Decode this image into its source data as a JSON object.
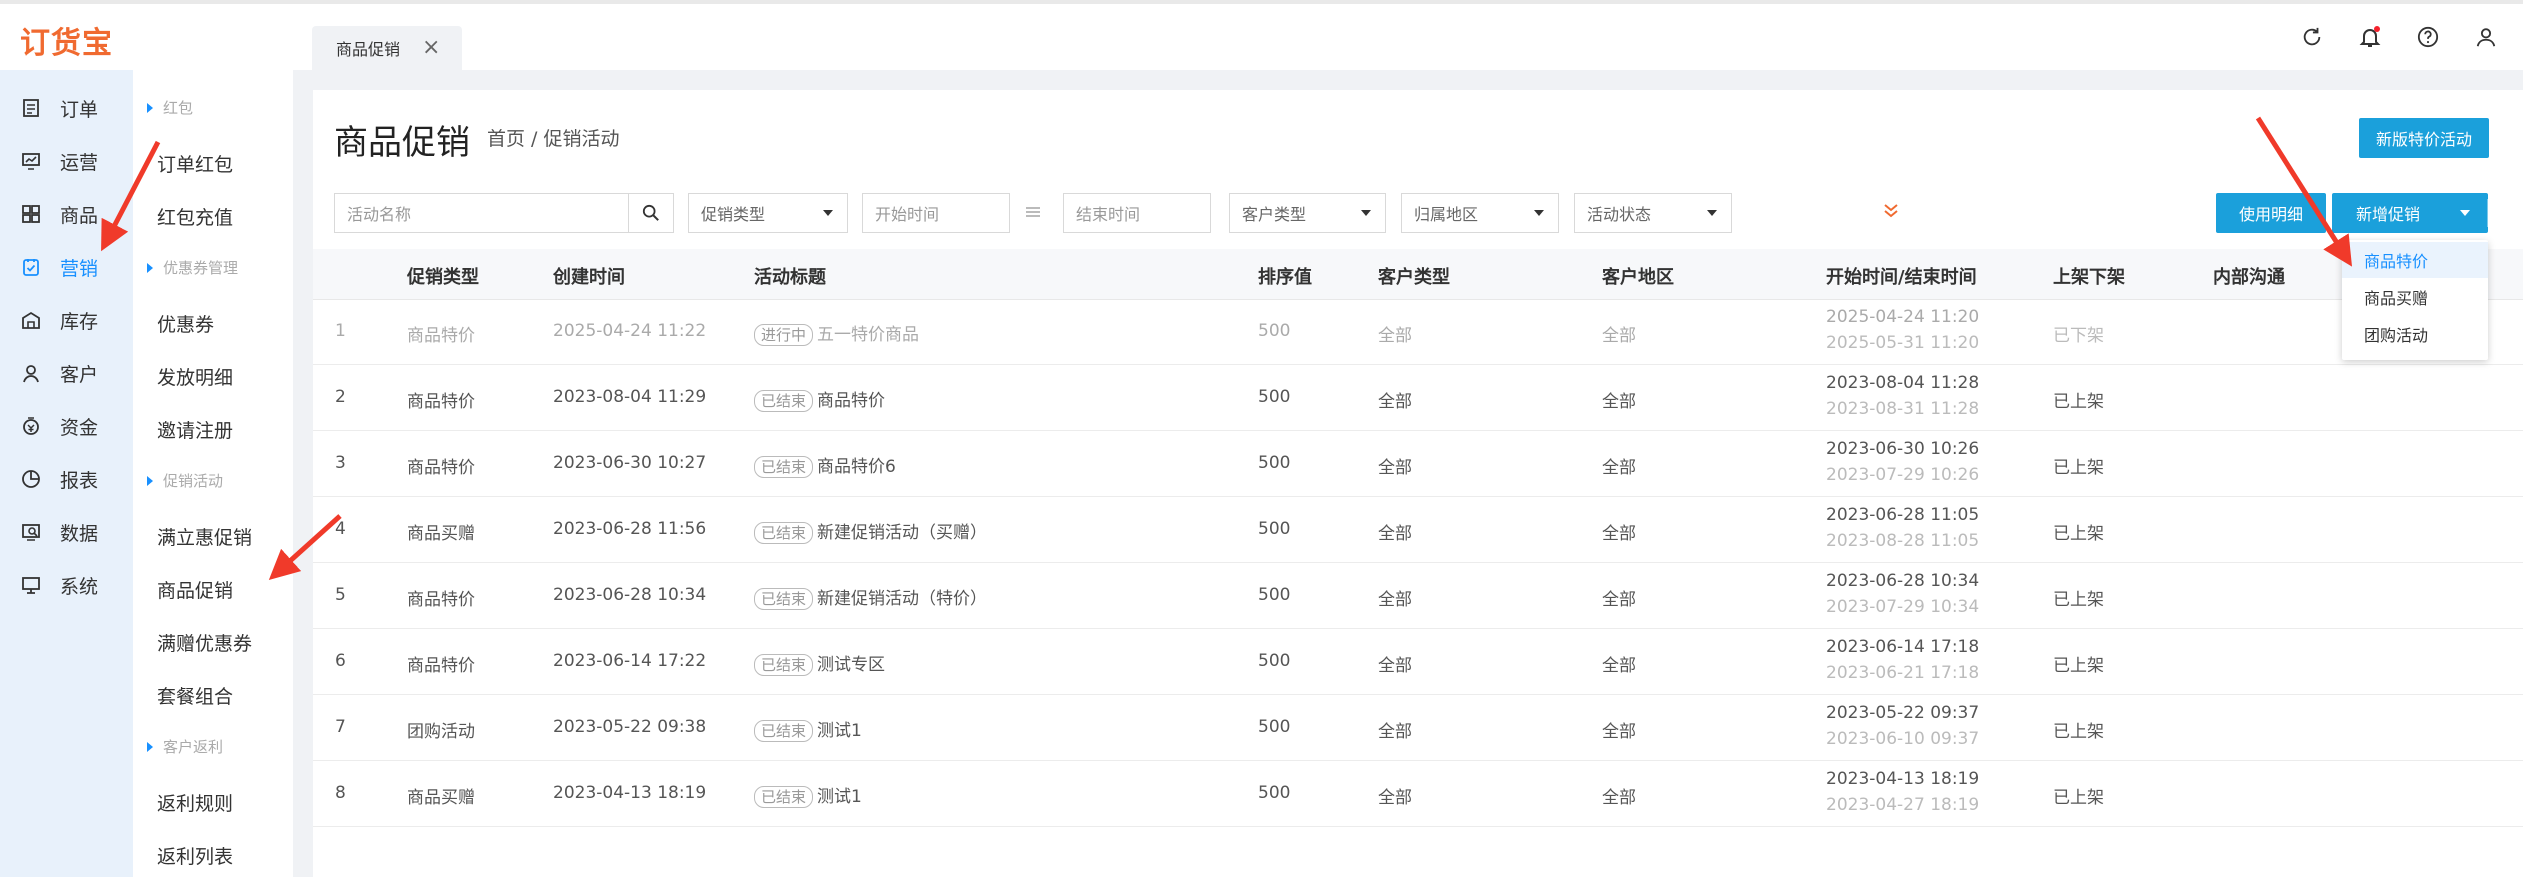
{
  "app": {
    "logo": "订货宝",
    "open_tab": "商品促销",
    "tab_close": "×"
  },
  "topbar_icons": [
    "refresh-icon",
    "bell-icon",
    "help-icon",
    "user-icon"
  ],
  "sidebar": {
    "items": [
      {
        "label": "订单",
        "icon": "order-icon"
      },
      {
        "label": "运营",
        "icon": "operation-icon"
      },
      {
        "label": "商品",
        "icon": "goods-icon"
      },
      {
        "label": "营销",
        "icon": "marketing-icon",
        "active": true
      },
      {
        "label": "库存",
        "icon": "warehouse-icon"
      },
      {
        "label": "客户",
        "icon": "customer-icon"
      },
      {
        "label": "资金",
        "icon": "money-icon"
      },
      {
        "label": "报表",
        "icon": "report-icon"
      },
      {
        "label": "数据",
        "icon": "data-icon"
      },
      {
        "label": "系统",
        "icon": "system-icon"
      }
    ]
  },
  "submenu": {
    "groups": [
      "红包",
      "优惠券管理",
      "促销活动",
      "客户返利"
    ],
    "items": [
      "订单红包",
      "红包充值",
      "优惠券",
      "发放明细",
      "邀请注册",
      "满立惠促销",
      "商品促销",
      "满赠优惠券",
      "套餐组合",
      "返利规则",
      "返利列表"
    ]
  },
  "page": {
    "title": "商品促销",
    "breadcrumb": "首页 / 促销活动",
    "new_special_button": "新版特价活动"
  },
  "filters": {
    "activity_name_placeholder": "活动名称",
    "promo_type": "促销类型",
    "start_time": "开始时间",
    "end_time": "结束时间",
    "customer_type": "客户类型",
    "region": "归属地区",
    "status": "活动状态",
    "usage_detail_button": "使用明细",
    "add_promo_button": "新增促销"
  },
  "dropdown": {
    "items": [
      "商品特价",
      "商品买赠",
      "团购活动"
    ]
  },
  "table": {
    "headers": [
      "促销类型",
      "创建时间",
      "活动标题",
      "排序值",
      "客户类型",
      "客户地区",
      "开始时间/结束时间",
      "上架下架",
      "内部沟通"
    ],
    "rows": [
      {
        "no": "1",
        "type": "商品特价",
        "created": "2025-04-24 11:22",
        "status": "进行中",
        "title": "五一特价商品",
        "sort": "500",
        "ctype": "全部",
        "region": "全部",
        "start": "2025-04-24 11:20",
        "end": "2025-05-31 11:20",
        "shelf": "已下架"
      },
      {
        "no": "2",
        "type": "商品特价",
        "created": "2023-08-04 11:29",
        "status": "已结束",
        "title": "商品特价",
        "sort": "500",
        "ctype": "全部",
        "region": "全部",
        "start": "2023-08-04 11:28",
        "end": "2023-08-31 11:28",
        "shelf": "已上架"
      },
      {
        "no": "3",
        "type": "商品特价",
        "created": "2023-06-30 10:27",
        "status": "已结束",
        "title": "商品特价6",
        "sort": "500",
        "ctype": "全部",
        "region": "全部",
        "start": "2023-06-30 10:26",
        "end": "2023-07-29 10:26",
        "shelf": "已上架"
      },
      {
        "no": "4",
        "type": "商品买赠",
        "created": "2023-06-28 11:56",
        "status": "已结束",
        "title": "新建促销活动（买赠）",
        "sort": "500",
        "ctype": "全部",
        "region": "全部",
        "start": "2023-06-28 11:05",
        "end": "2023-08-28 11:05",
        "shelf": "已上架"
      },
      {
        "no": "5",
        "type": "商品特价",
        "created": "2023-06-28 10:34",
        "status": "已结束",
        "title": "新建促销活动（特价）",
        "sort": "500",
        "ctype": "全部",
        "region": "全部",
        "start": "2023-06-28 10:34",
        "end": "2023-07-29 10:34",
        "shelf": "已上架"
      },
      {
        "no": "6",
        "type": "商品特价",
        "created": "2023-06-14 17:22",
        "status": "已结束",
        "title": "测试专区",
        "sort": "500",
        "ctype": "全部",
        "region": "全部",
        "start": "2023-06-14 17:18",
        "end": "2023-06-21 17:18",
        "shelf": "已上架"
      },
      {
        "no": "7",
        "type": "团购活动",
        "created": "2023-05-22 09:38",
        "status": "已结束",
        "title": "测试1",
        "sort": "500",
        "ctype": "全部",
        "region": "全部",
        "start": "2023-05-22 09:37",
        "end": "2023-06-10 09:37",
        "shelf": "已上架"
      },
      {
        "no": "8",
        "type": "商品买赠",
        "created": "2023-04-13 18:19",
        "status": "已结束",
        "title": "测试1",
        "sort": "500",
        "ctype": "全部",
        "region": "全部",
        "start": "2023-04-13 18:19",
        "end": "2023-04-27 18:19",
        "shelf": "已上架"
      }
    ]
  },
  "colors": {
    "accent": "#1ba0db",
    "active_nav": "#1890ff",
    "logo": "#f06a30",
    "annotation_arrow": "#f03a2a"
  }
}
